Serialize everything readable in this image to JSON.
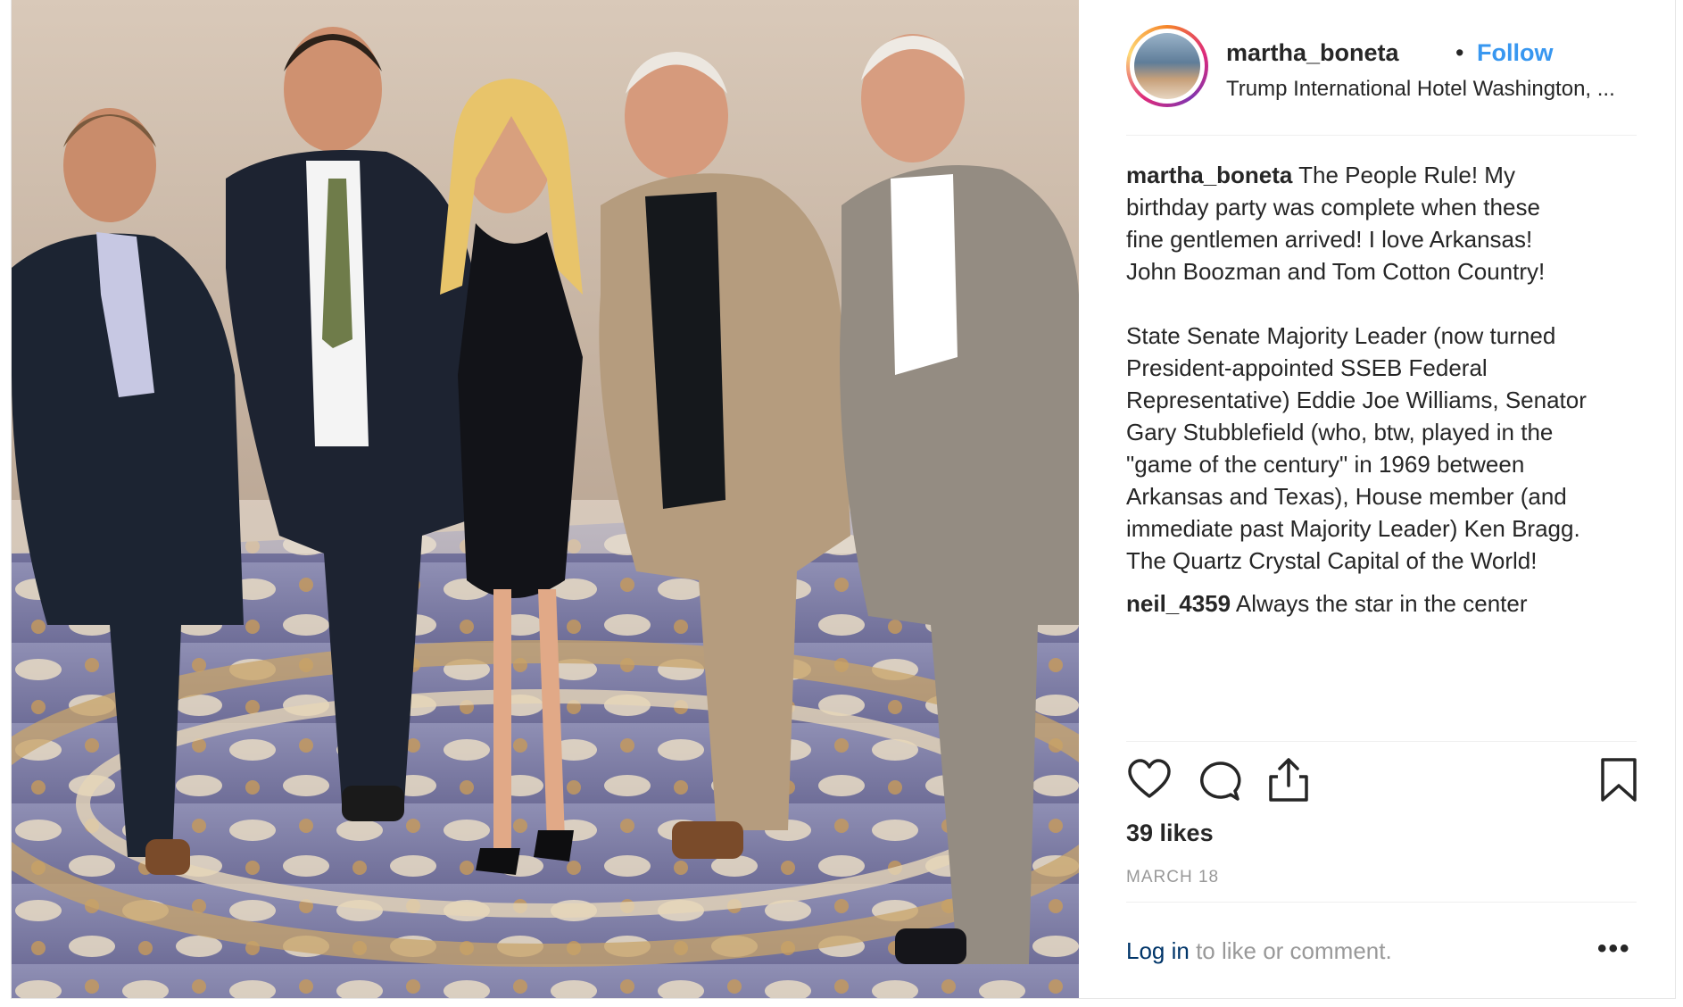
{
  "post": {
    "username": "martha_boneta",
    "separator": "•",
    "follow_label": "Follow",
    "location": "Trump International Hotel Washington, ..."
  },
  "caption": {
    "author": "martha_boneta",
    "lines": [
      "The People Rule! My",
      "birthday party was complete when these",
      "fine gentlemen arrived! I love Arkansas!",
      "John Boozman and Tom Cotton Country!",
      "",
      "State Senate Majority Leader (now turned",
      "President-appointed SSEB Federal",
      "Representative) Eddie Joe Williams, Senator",
      "Gary Stubblefield (who, btw, played in the",
      "\"game of the century\" in 1969 between",
      "Arkansas and Texas), House member (and",
      "immediate past Majority Leader) Ken Bragg.",
      "The Quartz Crystal Capital of the World!"
    ]
  },
  "comments": [
    {
      "author": "neil_4359",
      "text": "Always the star in the center"
    }
  ],
  "actions": {
    "like_icon": "heart-icon",
    "comment_icon": "comment-bubble-icon",
    "share_icon": "share-upload-icon",
    "save_icon": "bookmark-icon"
  },
  "likes": "39 likes",
  "date": "MARCH 18",
  "login": {
    "link": "Log in",
    "text": " to like or comment.",
    "more": "•••"
  },
  "colors": {
    "follow": "#3897f0",
    "login_link": "#003569",
    "muted": "#999999",
    "text": "#262626"
  }
}
